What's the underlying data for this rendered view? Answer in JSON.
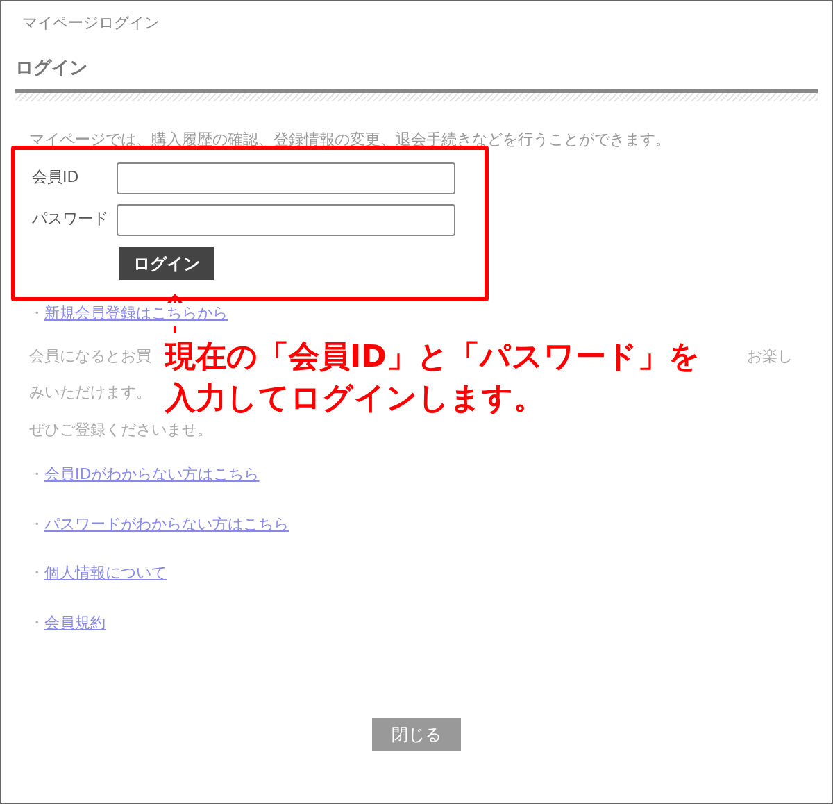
{
  "window": {
    "title": "マイページログイン"
  },
  "heading": "ログイン",
  "intro": "マイページでは、購入履歴の確認、登録情報の変更、退会手続きなどを行うことができます。",
  "form": {
    "fields": [
      {
        "label": "会員ID"
      },
      {
        "label": "パスワード"
      }
    ],
    "submit": "ログイン"
  },
  "register_link": {
    "bullet": "・",
    "label": "新規会員登録はこちらから"
  },
  "benefits": {
    "line1_start": "会員になるとお買",
    "line1_end": "お楽し",
    "line2": "みいただけます。",
    "line3": "ぜひご登録くださいませ。"
  },
  "links": [
    {
      "bullet": "・",
      "label": "会員IDがわからない方はこちら"
    },
    {
      "bullet": "・",
      "label": "パスワードがわからない方はこちら"
    },
    {
      "bullet": "・",
      "label": "個人情報について"
    },
    {
      "bullet": "・",
      "label": "会員規約"
    }
  ],
  "close_button": "閉じる",
  "annotation": {
    "lines": [
      "現在の「会員ID」と「パスワード」を",
      "入力してログインします。"
    ]
  }
}
